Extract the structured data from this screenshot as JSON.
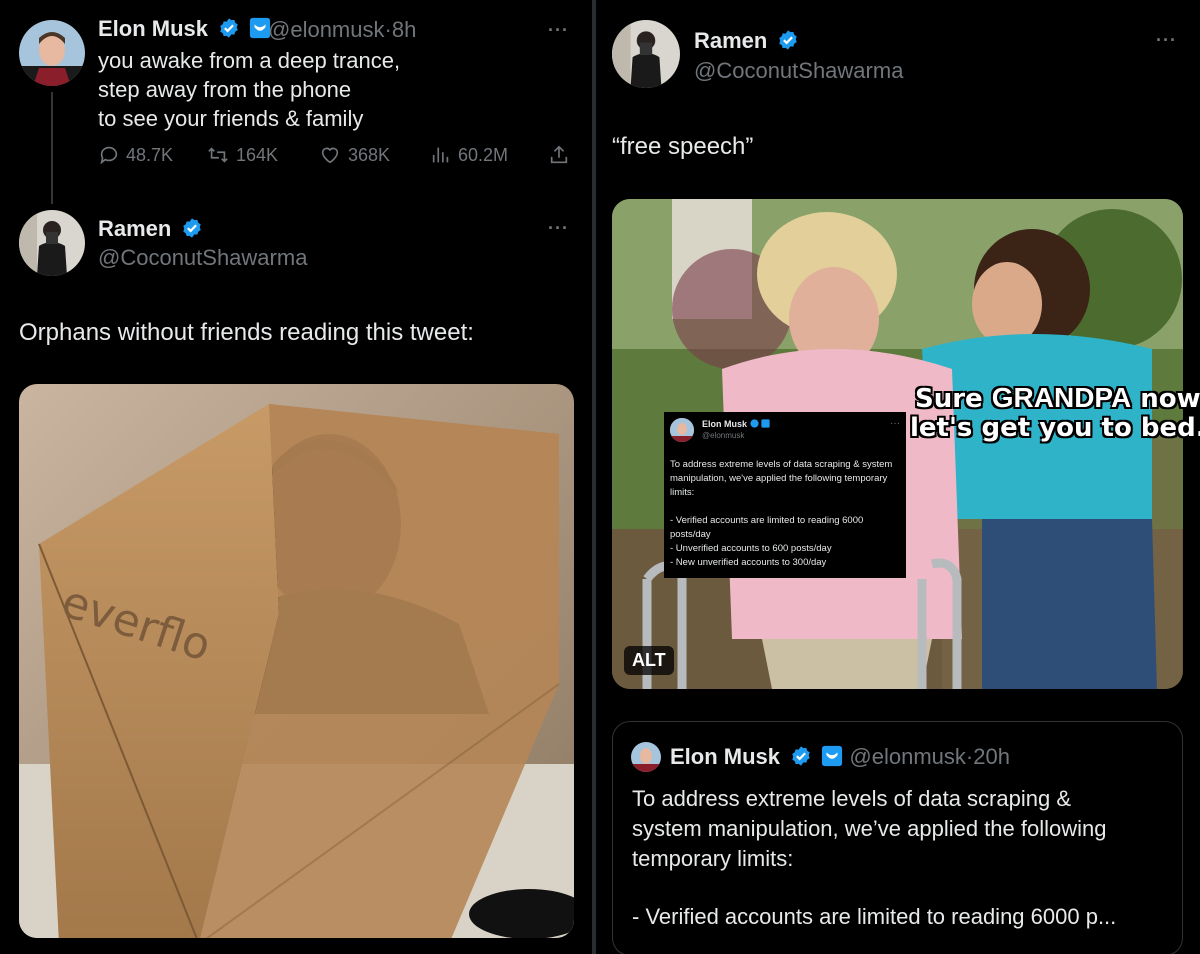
{
  "left_panel": {
    "tweet1": {
      "author": "Elon Musk",
      "handle": "@elonmusk",
      "separator": "·",
      "time": "8h",
      "text": "you awake from a deep trance,\nstep away from the phone\nto see your friends & family",
      "replies": "48.7K",
      "retweets": "164K",
      "likes": "368K",
      "views": "60.2M"
    },
    "tweet2": {
      "author": "Ramen",
      "handle": "@CoconutShawarma",
      "text": "Orphans without friends reading this tweet:",
      "image_box_text": "everflo"
    }
  },
  "right_panel": {
    "tweet": {
      "author": "Ramen",
      "handle": "@CoconutShawarma",
      "text": "“free speech”",
      "alt_label": "ALT",
      "meme_caption_line1_a": "Sure ",
      "meme_caption_line1_b": "GRANDPA",
      "meme_caption_line1_c": " now",
      "meme_caption_line2": "let's get you to bed.",
      "embedded_tweet": {
        "author": "Elon Musk",
        "handle": "@elonmusk",
        "text": "To address extreme levels of data scraping & system manipulation, we've applied the following temporary limits:\n\n- Verified accounts are limited to reading 6000 posts/day\n- Unverified accounts to 600 posts/day\n- New unverified accounts to 300/day"
      }
    },
    "quote": {
      "author": "Elon Musk",
      "handle": "@elonmusk",
      "separator": "·",
      "time": "20h",
      "text": "To address extreme levels of data scraping &\nsystem manipulation, we’ve applied the following\ntemporary limits:",
      "truncated_line": "- Verified accounts are limited to reading 6000 p..."
    }
  },
  "colors": {
    "background": "#000000",
    "text": "#e7e9ea",
    "muted": "#71767b",
    "verified_blue": "#1d9bf0",
    "border": "#2f3336"
  }
}
